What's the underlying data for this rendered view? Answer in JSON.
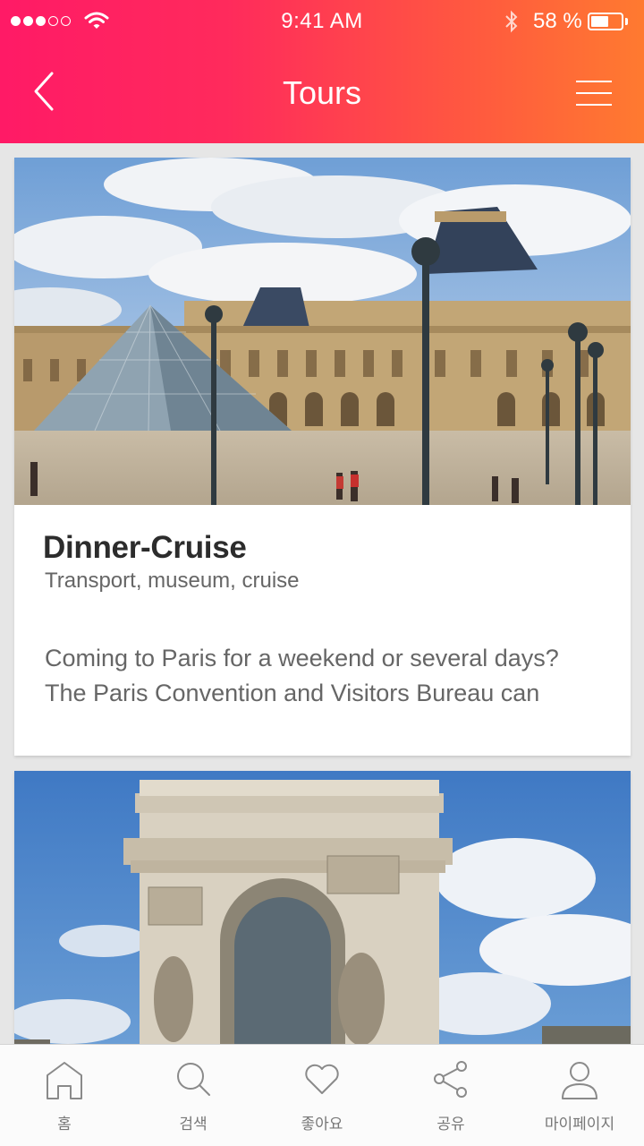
{
  "status_bar": {
    "time": "9:41 AM",
    "battery_text": "58 %",
    "signal_bars_filled": 3,
    "signal_bars_total": 5,
    "battery_level": 0.58
  },
  "nav": {
    "title": "Tours",
    "back_icon": "chevron-left-icon",
    "menu_icon": "hamburger-menu-icon"
  },
  "cards": [
    {
      "image": "louvre-pyramid-photo",
      "title": "Dinner-Cruise",
      "subtitle": "Transport, museum, cruise",
      "description_line1": "Coming to Paris for a weekend or several days?",
      "description_line2": "The Paris Convention and Visitors Bureau can"
    },
    {
      "image": "arc-de-triomphe-photo"
    }
  ],
  "tab_bar": {
    "items": [
      {
        "label": "홈",
        "icon": "home-icon"
      },
      {
        "label": "검색",
        "icon": "search-icon"
      },
      {
        "label": "좋아요",
        "icon": "heart-icon"
      },
      {
        "label": "공유",
        "icon": "share-icon"
      },
      {
        "label": "마이페이지",
        "icon": "user-icon"
      }
    ]
  },
  "colors": {
    "header_gradient_start": "#ff1a66",
    "header_gradient_end": "#ff7a30",
    "text_dark": "#2c2c2c",
    "text_muted": "#666666",
    "background": "#e6e6e6"
  }
}
